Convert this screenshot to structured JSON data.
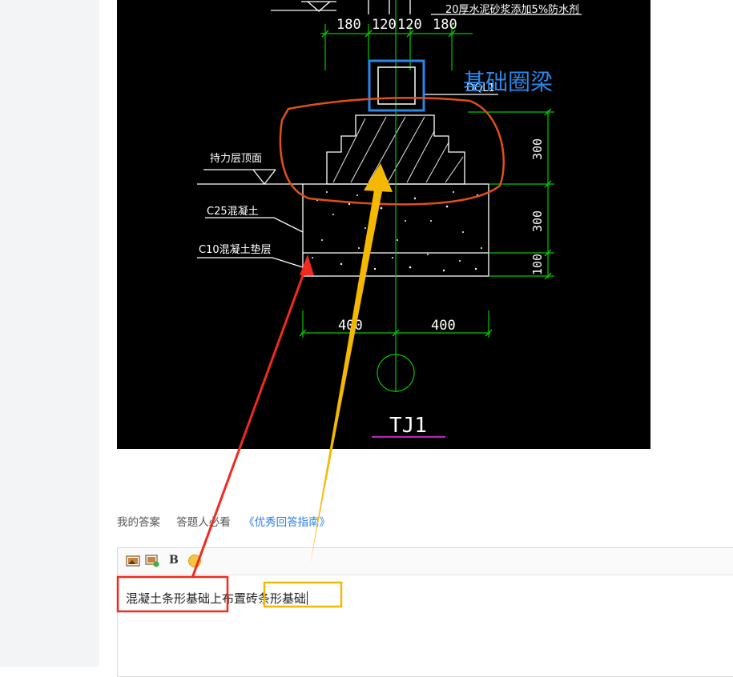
{
  "cad": {
    "dims_top": [
      "180",
      "120",
      "120",
      "180"
    ],
    "waterproof_note": "20厚水泥砂浆添加5%防水剂",
    "beam_code": "DQL1",
    "beam_annotation": "基础圈梁",
    "bearing_layer": "持力层顶面",
    "concrete_c25": "C25混凝土",
    "concrete_c10": "C10混凝土垫层",
    "dim_right": [
      "300",
      "300",
      "100"
    ],
    "dim_bottom": [
      "400",
      "400"
    ],
    "drawing_id": "TJ1"
  },
  "answer_bar": {
    "my_answer": "我的答案",
    "must_read": "答题人必看",
    "guide_link": "《优秀回答指南》"
  },
  "editor": {
    "text_part1": "混凝土条形基础",
    "text_part2": "上布置",
    "text_part3": "砖条形基础"
  },
  "colors": {
    "annotation_blue": "#2b86e8",
    "annotation_red": "#f02a1e",
    "annotation_yellow": "#f5b800",
    "circle_orange": "#e0501a",
    "cad_green": "#00c800",
    "cad_bg": "#000000"
  }
}
